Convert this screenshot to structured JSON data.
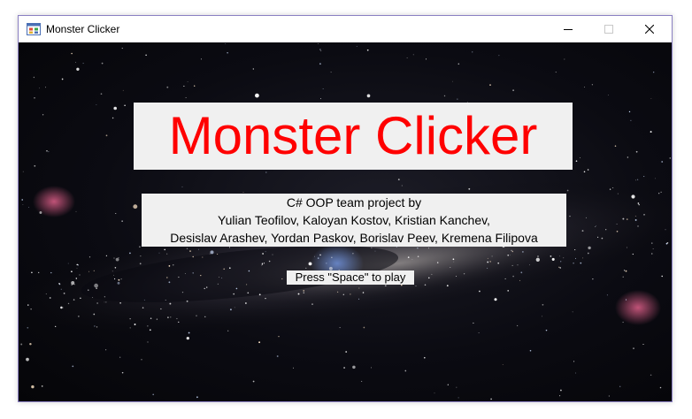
{
  "window": {
    "title": "Monster Clicker",
    "app_icon": "windows-form-icon",
    "controls": {
      "minimize_icon": "minimize-icon",
      "maximize_icon": "maximize-icon",
      "close_icon": "close-icon"
    }
  },
  "main": {
    "heading": "Monster Clicker",
    "credits": [
      "C# OOP team project by",
      "Yulian Teofilov, Kaloyan Kostov, Kristian Kanchev,",
      "Desislav Arashev, Yordan Paskov, Borislav Peev, Kremena Filipova"
    ],
    "play_prompt": "Press \"Space\" to play"
  },
  "colors": {
    "heading_text": "#ff0000",
    "panel_background": "#f0f0f0",
    "window_border": "#8a7fc2",
    "background": "#0b0b12"
  }
}
